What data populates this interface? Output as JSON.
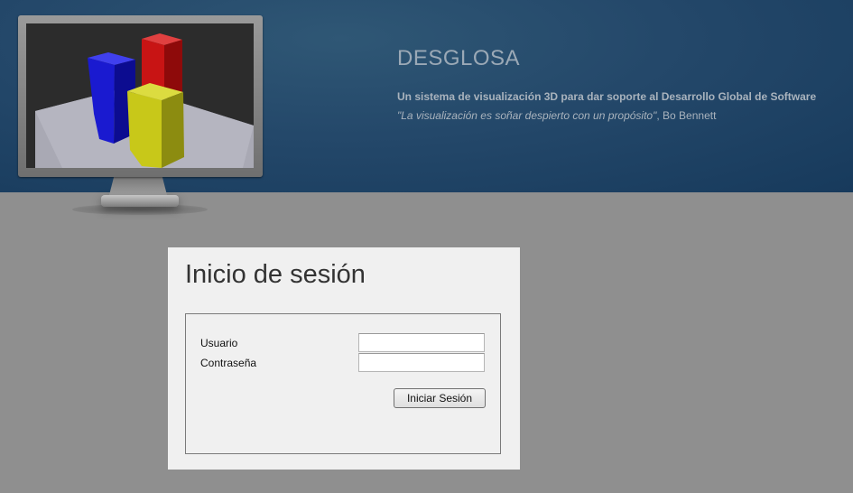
{
  "header": {
    "title": "DESGLOSA",
    "subtitle": "Un sistema de visualización 3D para dar soporte al Desarrollo Global de Software",
    "quote": "\"La visualización es soñar despierto con un propósito\"",
    "quote_author": ", Bo Bennett",
    "monitor_bars": [
      {
        "color": "#1a1ad0",
        "name": "blue"
      },
      {
        "color": "#c81414",
        "name": "red"
      },
      {
        "color": "#c8c819",
        "name": "yellow"
      }
    ]
  },
  "login": {
    "title": "Inicio de sesión",
    "username_label": "Usuario",
    "username_value": "",
    "password_label": "Contraseña",
    "password_value": "",
    "submit_label": "Iniciar Sesión"
  }
}
